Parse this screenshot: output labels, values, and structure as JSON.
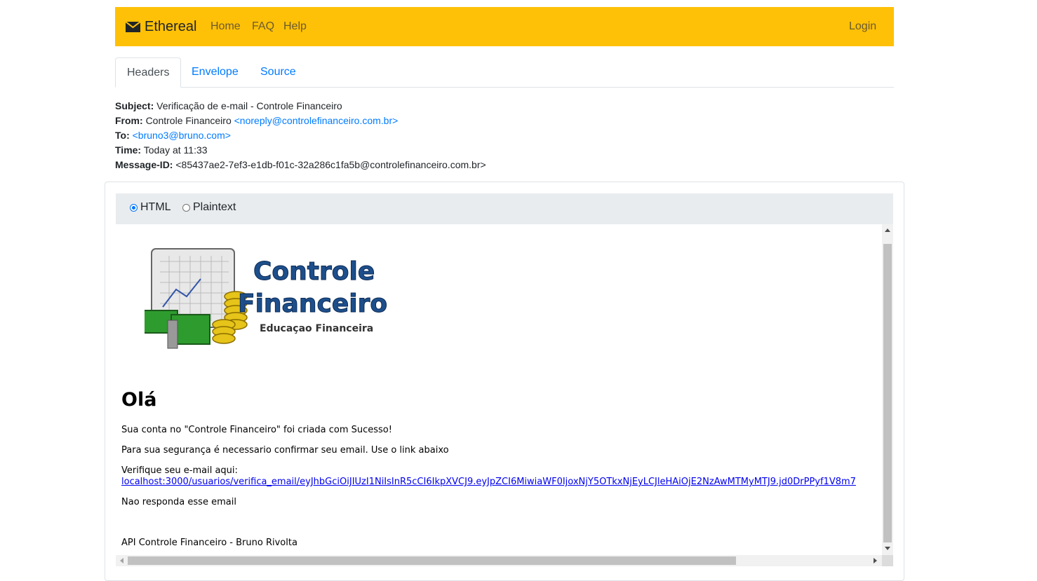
{
  "navbar": {
    "brand": "Ethereal",
    "links": [
      "Home",
      "FAQ",
      "Help"
    ],
    "login": "Login",
    "color": "#ffc107"
  },
  "tabs": [
    "Headers",
    "Envelope",
    "Source"
  ],
  "headers": {
    "subject_label": "Subject:",
    "subject": "Verificação de e-mail - Controle Financeiro",
    "from_label": "From:",
    "from_name": "Controle Financeiro",
    "from_email": "<noreply@controlefinanceiro.com.br>",
    "to_label": "To:",
    "to_email": "<bruno3@bruno.com>",
    "time_label": "Time:",
    "time": "Today at 11:33",
    "message_id_label": "Message-ID:",
    "message_id": "<85437ae2-7ef3-e1db-f01c-32a286c1fa5b@controlefinanceiro.com.br>"
  },
  "view_mode": {
    "options": [
      "HTML",
      "Plaintext"
    ],
    "selected": "HTML"
  },
  "email": {
    "logo_title_line1": "Controle",
    "logo_title_line2": "Financeiro",
    "logo_subtitle": "Educaçao Financeira",
    "greeting": "Olá",
    "line1": "Sua conta no \"Controle Financeiro\" foi criada com Sucesso!",
    "line2": "Para sua segurança é necessario confirmar seu email. Use o link abaixo",
    "verify_label": "Verifique seu e-mail aqui:",
    "verify_link": "localhost:3000/usuarios/verifica_email/eyJhbGciOiJIUzI1NiIsInR5cCI6IkpXVCJ9.eyJpZCI6MiwiaWF0IjoxNjY5OTkxNjEyLCJleHAiOjE2NzAwMTMyMTJ9.jd0DrPPyf1V8m7",
    "no_reply": "Nao responda esse email",
    "signature": "API Controle Financeiro - Bruno Rivolta"
  }
}
